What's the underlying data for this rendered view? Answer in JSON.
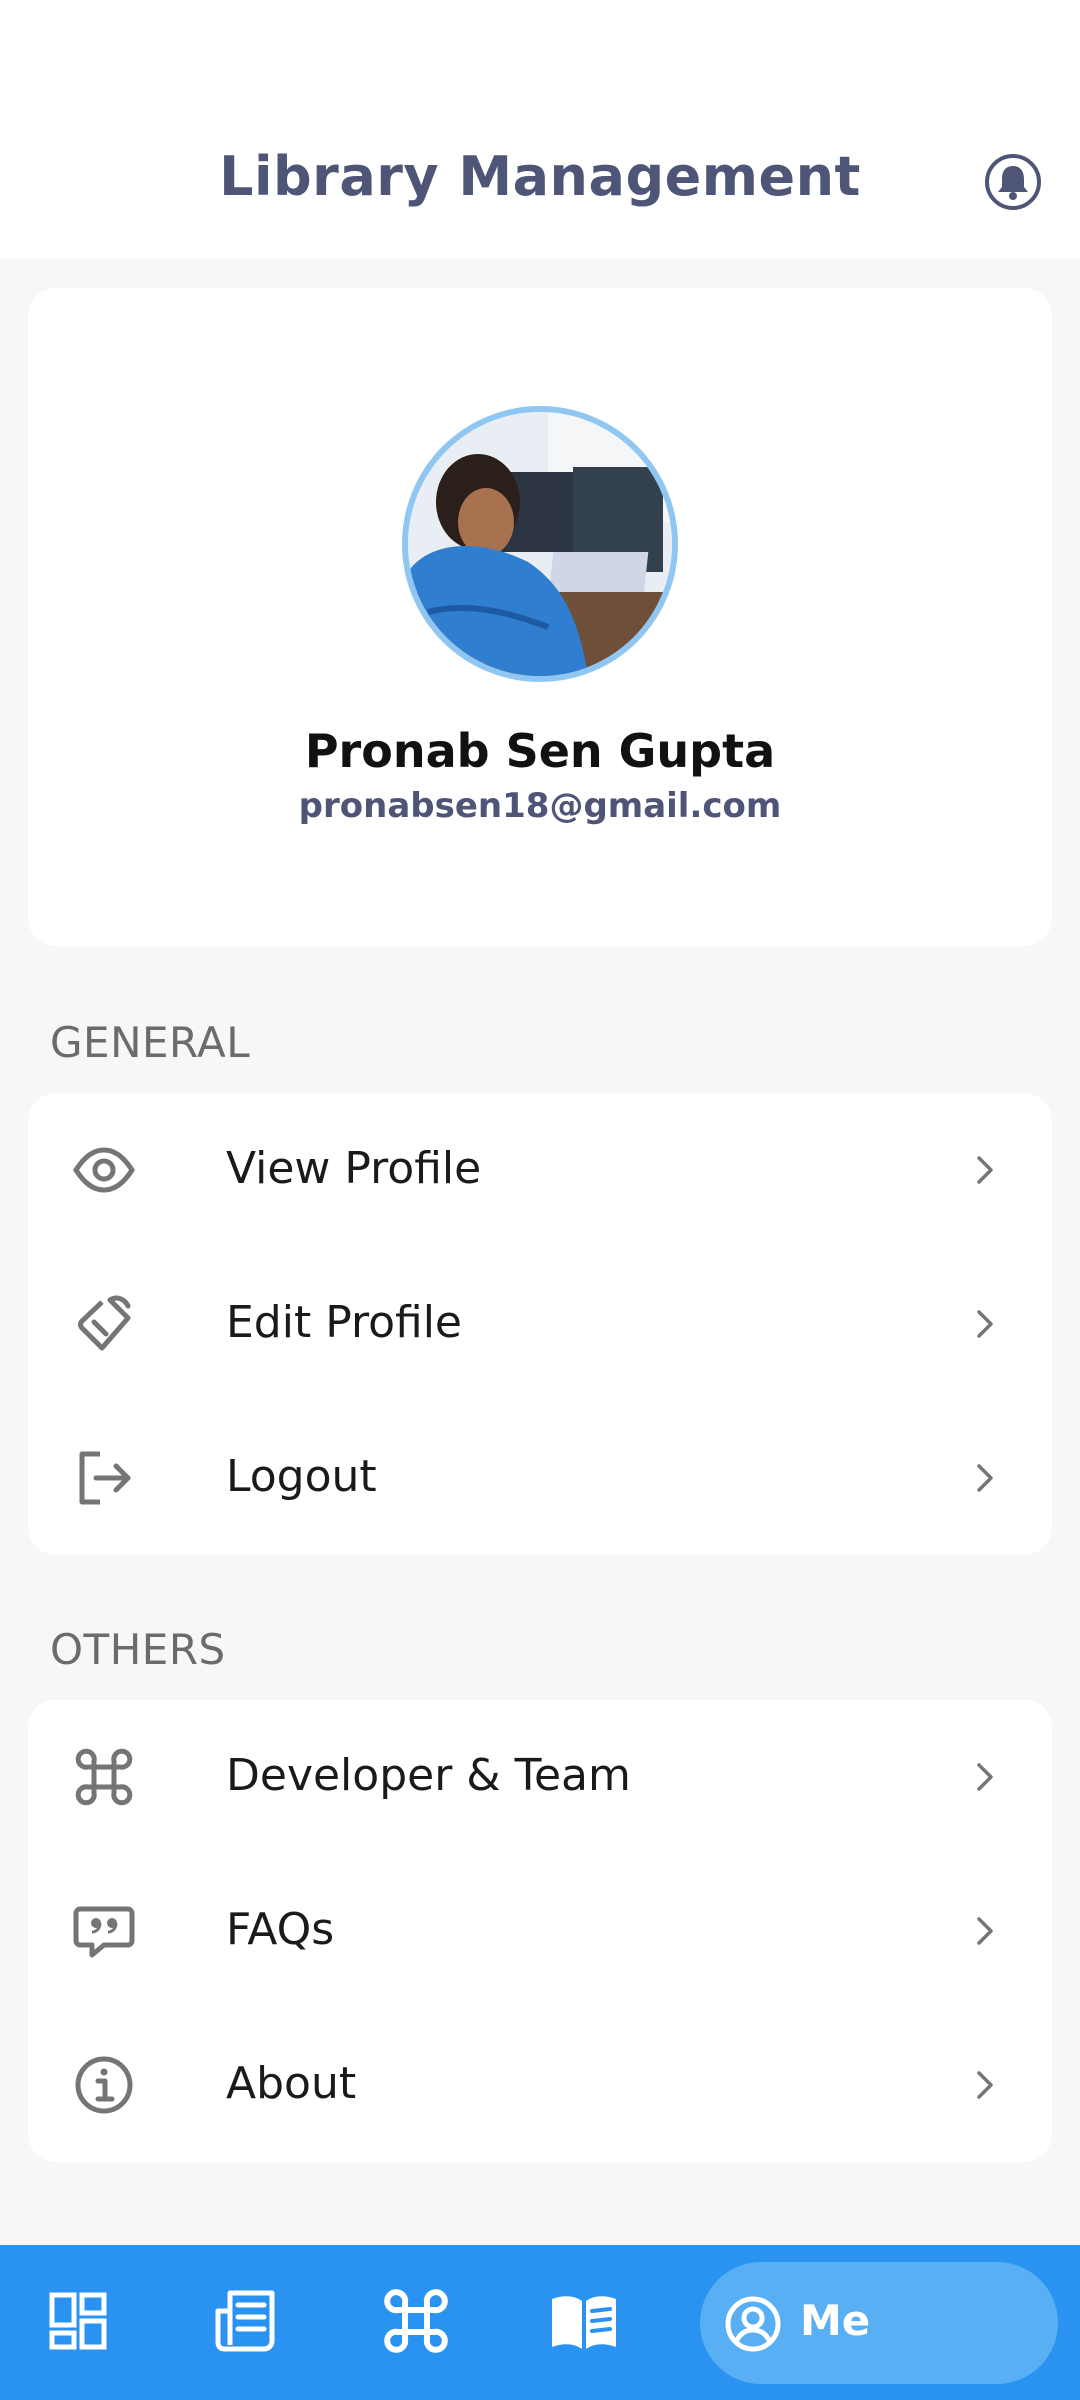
{
  "header": {
    "title": "Library Management",
    "notification_icon": "bell-icon"
  },
  "profile": {
    "name": "Pronab Sen Gupta",
    "email": "pronabsen18@gmail.com",
    "avatar_description_icon": "avatar-photo"
  },
  "sections": {
    "general": {
      "title": "GENERAL",
      "items": [
        {
          "label": "View Profile",
          "icon": "eye-icon"
        },
        {
          "label": "Edit Profile",
          "icon": "pencil-tag-icon"
        },
        {
          "label": "Logout",
          "icon": "logout-icon"
        }
      ]
    },
    "others": {
      "title": "OTHERS",
      "items": [
        {
          "label": "Developer & Team",
          "icon": "command-icon"
        },
        {
          "label": "FAQs",
          "icon": "quote-bubble-icon"
        },
        {
          "label": "About",
          "icon": "info-icon"
        }
      ]
    }
  },
  "bottom_nav": {
    "items": [
      {
        "icon": "dashboard-icon"
      },
      {
        "icon": "newspaper-icon"
      },
      {
        "icon": "command-icon"
      },
      {
        "icon": "open-book-icon"
      }
    ],
    "active": {
      "label": "Me",
      "icon": "user-circle-icon"
    }
  },
  "colors": {
    "accent": "#2a92f0",
    "accent_active": "#58aff4",
    "title": "#4f5577",
    "background": "#f7f7f8"
  }
}
